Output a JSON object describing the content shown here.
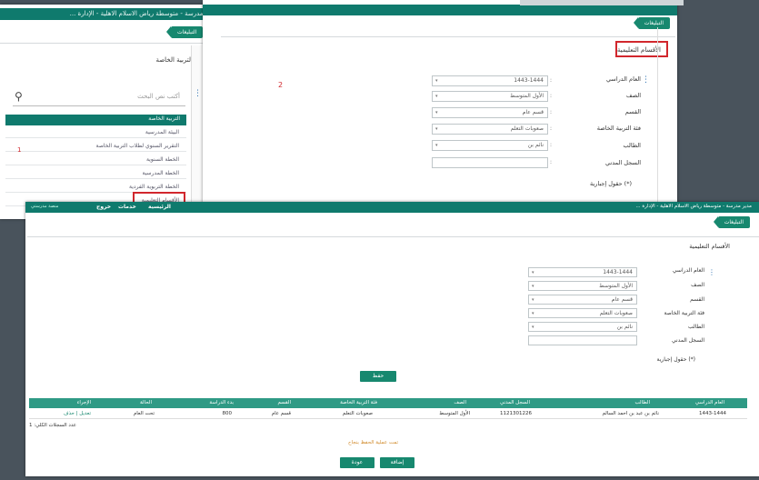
{
  "colors": {
    "teal": "#0f7a6d",
    "accent": "#17886f",
    "highlight": "#d1272d",
    "text": "#333333"
  },
  "shot1": {
    "breadcrumb": "مدير مدرسة - متوسطة رياض الاسلام الاهلية - الإدارة ...",
    "notifications": "التبليغات",
    "menu_title": "التربية الخاصة",
    "search_placeholder": "أكتب نص البحث",
    "section_header": "التربية الخاصة",
    "menu_items": [
      "البيئة المدرسية",
      "التقرير السنوي لطلاب التربية الخاصة",
      "الخطة السنوية",
      "الخطة المدرسية",
      "الخطة التربوية الفردية",
      "الأقسام التعليمية"
    ],
    "marker": "1"
  },
  "shot2": {
    "notifications": "التبليغات",
    "page_title": "الأقسام التعليمية",
    "marker": "2",
    "labels": [
      "العام الدراسي",
      "الصف",
      "القسم",
      "فئة التربية الخاصة",
      "الطالب",
      "السجل المدني",
      "(*) حقول إجبارية"
    ],
    "values": [
      "1443-1444",
      "الأول المتوسط",
      "قسم عام",
      "صعوبات التعلم",
      "نائم بن",
      ""
    ]
  },
  "shot3": {
    "nav": [
      "الرئيسية",
      "خدمات",
      "خروج"
    ],
    "logo": "منصة مدرستي",
    "breadcrumb": "مدير مدرسة - متوسطة رياض الاسلام الاهلية - الإدارة ...",
    "notifications": "التبليغات",
    "page_title": "الأقسام التعليمية",
    "labels": [
      "العام الدراسي",
      "الصف",
      "القسم",
      "فئة التربية الخاصة",
      "الطالب",
      "السجل المدني",
      "(*) حقول إجبارية"
    ],
    "values": [
      "1443-1444",
      "الأول المتوسط",
      "قسم عام",
      "صعوبات التعلم",
      "نائم بن",
      ""
    ],
    "save_label": "حفظ",
    "table": {
      "headers": [
        "العام الدراسي",
        "الطالب",
        "السجل المدني",
        "الصف",
        "فئة التربية الخاصة",
        "القسم",
        "بدء الدراسة",
        "الحالة",
        "الإجراء"
      ],
      "row": [
        "1443-1444",
        "نائم بن عبد بن احمد السالم",
        "1121301226",
        "الأول المتوسط",
        "صعوبات التعلم",
        "قسم عام",
        "800",
        "تحت العام",
        "تعديل | حذف"
      ]
    },
    "records_count": "عدد السجلات الكلي: 1",
    "footer_note": "تمت عملية الحفظ بنجاح",
    "btn_back": "عودة",
    "btn_next": "إضافة"
  }
}
